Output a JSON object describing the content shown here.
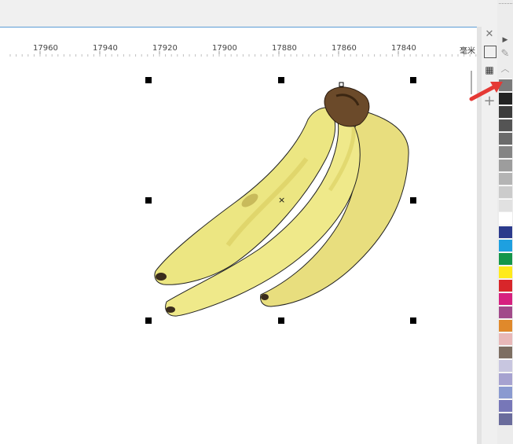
{
  "ruler": {
    "labels": [
      "17960",
      "17940",
      "17920",
      "17900",
      "17880",
      "17860",
      "17840"
    ],
    "unit": "毫米"
  },
  "icons": {
    "close": "close-icon",
    "rectangle": "rectangle-tool-icon",
    "hatch": "hatch-tool-icon",
    "add": "add-icon",
    "dropper": "eyedropper-icon",
    "play": "play-triangle-icon",
    "up": "chevron-up-icon",
    "arrow": "red-arrow-annotation"
  },
  "palette": {
    "colors": [
      "#7a7a7a",
      "#232323",
      "#3c3c3c",
      "#545454",
      "#6b6b6b",
      "#858585",
      "#9d9d9d",
      "#b4b4b4",
      "#cbcbcb",
      "#e1e1e1",
      "#ffffff",
      "#2b3a8c",
      "#1ea0e0",
      "#14964a",
      "#ffea1a",
      "#d8262a",
      "#d6207f",
      "#a24a8a",
      "#e0892b",
      "#e8b8b8",
      "#7d6e62",
      "#c8c6e0",
      "#a6a2d0",
      "#8a9ad0",
      "#7777b8",
      "#6a6c9c"
    ]
  },
  "selection": {
    "center_marker": "×"
  }
}
